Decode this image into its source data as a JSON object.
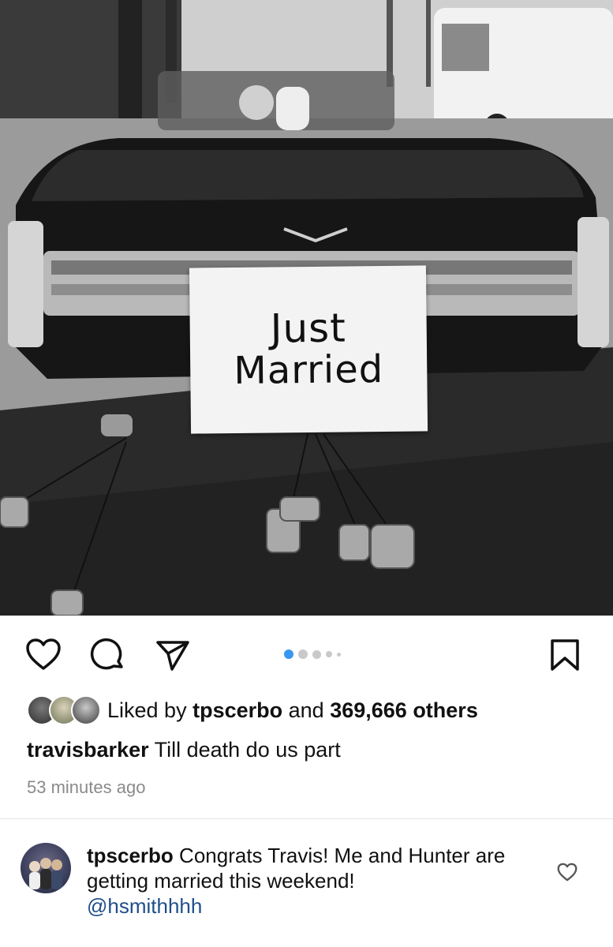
{
  "post": {
    "sign_line1": "Just",
    "sign_line2": "Married"
  },
  "actions": {
    "like_icon": "heart-icon",
    "comment_icon": "comment-icon",
    "share_icon": "send-icon",
    "save_icon": "bookmark-icon",
    "carousel_position": 1,
    "carousel_dots": 5
  },
  "likes": {
    "prefix": "Liked by",
    "user": "tpscerbo",
    "and": "and",
    "count": "369,666 others"
  },
  "caption": {
    "user": "travisbarker",
    "text": "Till death do us part"
  },
  "timestamp": "53 minutes ago",
  "comment": {
    "user": "tpscerbo",
    "text": "Congrats Travis! Me and Hunter are getting married this weekend!",
    "mention": "@hsmithhhh"
  },
  "colors": {
    "carousel_active": "#3897f0",
    "mention": "#1f4e8a",
    "timestamp": "#8a8a8a"
  }
}
